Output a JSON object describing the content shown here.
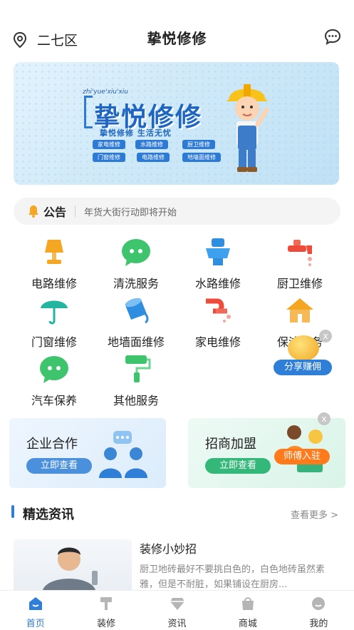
{
  "header": {
    "location": "二七区",
    "title": "挚悦修修",
    "location_icon": "location-pin-icon",
    "message_icon": "chat-bubble-icon"
  },
  "banner": {
    "pinyin": "zhi'yue'xiu'xiu",
    "title": "挚悦修修",
    "subtitle": "挚悦修修 生活无忧",
    "tags": [
      "家电维修",
      "水路维修",
      "厨卫维修",
      "门窗维修",
      "电路维修",
      "地墙面维修"
    ]
  },
  "notice": {
    "label": "公告",
    "text": "年货大街行动即将开始"
  },
  "services": [
    {
      "label": "电路维修",
      "icon": "lamp-icon",
      "color": "#f5a623"
    },
    {
      "label": "清洗服务",
      "icon": "chat-wechat-icon",
      "color": "#3ec46d"
    },
    {
      "label": "水路维修",
      "icon": "toilet-icon",
      "color": "#2f8ee0"
    },
    {
      "label": "厨卫维修",
      "icon": "faucet-icon",
      "color": "#ee4b3a"
    },
    {
      "label": "门窗维修",
      "icon": "umbrella-icon",
      "color": "#24b5a0"
    },
    {
      "label": "地墙面维修",
      "icon": "paint-bucket-icon",
      "color": "#2f8ee0"
    },
    {
      "label": "家电维修",
      "icon": "pipe-icon",
      "color": "#ee4b3a"
    },
    {
      "label": "保洁服务",
      "icon": "house-icon",
      "color": "#f5a623"
    },
    {
      "label": "汽车保养",
      "icon": "chat-wechat-icon",
      "color": "#3ec46d"
    },
    {
      "label": "其他服务",
      "icon": "paint-roller-icon",
      "color": "#3ec46d"
    }
  ],
  "share": {
    "label": "分享赚佣",
    "close": "x"
  },
  "cards": {
    "enterprise": {
      "title": "企业合作",
      "button": "立即查看"
    },
    "merchant": {
      "title": "招商加盟",
      "button": "立即查看"
    },
    "master_badge": "师傅入驻",
    "master_close": "x"
  },
  "news": {
    "section_title": "精选资讯",
    "more": "查看更多 >",
    "items": [
      {
        "title": "装修小妙招",
        "desc": "厨卫地砖最好不要挑白色的，白色地砖虽然素雅，但是不耐脏，如果铺设在厨房..."
      }
    ]
  },
  "tabbar": [
    {
      "label": "首页",
      "icon": "home-icon",
      "active": true
    },
    {
      "label": "装修",
      "icon": "hammer-icon",
      "active": false
    },
    {
      "label": "资讯",
      "icon": "diamond-icon",
      "active": false
    },
    {
      "label": "商城",
      "icon": "shopping-bag-icon",
      "active": false
    },
    {
      "label": "我的",
      "icon": "user-icon",
      "active": false
    }
  ],
  "colors": {
    "accent": "#2f7fd8",
    "banner_blue": "#1e66c2",
    "green": "#34b879",
    "orange": "#ff7a1a"
  }
}
